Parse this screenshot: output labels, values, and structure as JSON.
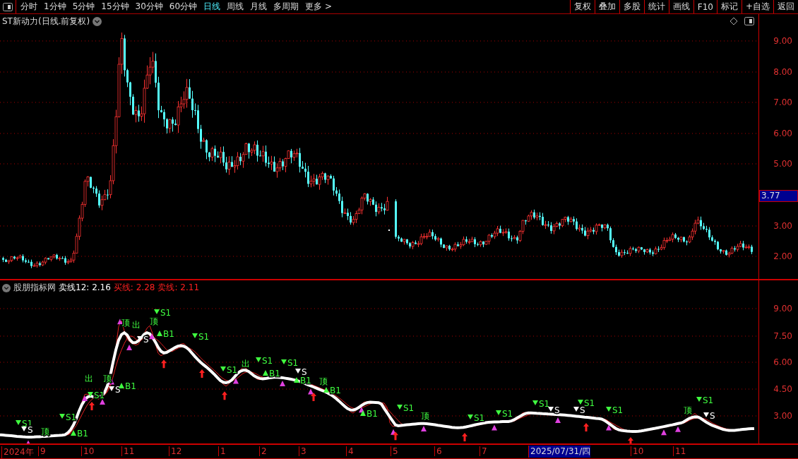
{
  "toolbar": {
    "periods": [
      {
        "label": "分时",
        "selected": false
      },
      {
        "label": "1分钟",
        "selected": false
      },
      {
        "label": "5分钟",
        "selected": false
      },
      {
        "label": "15分钟",
        "selected": false
      },
      {
        "label": "30分钟",
        "selected": false
      },
      {
        "label": "60分钟",
        "selected": false
      },
      {
        "label": "日线",
        "selected": true
      },
      {
        "label": "周线",
        "selected": false
      },
      {
        "label": "月线",
        "selected": false
      },
      {
        "label": "多周期",
        "selected": false
      },
      {
        "label": "更多 >",
        "selected": false
      }
    ],
    "buttons": [
      "复权",
      "叠加",
      "多股",
      "统计",
      "画线",
      "F10",
      "标记",
      "+自选",
      "返回"
    ]
  },
  "price_pane": {
    "title": "ST新动力(日线.前复权)",
    "y_ticks": [
      "9.00",
      "8.00",
      "7.00",
      "6.00",
      "5.00",
      "3.00",
      "2.00"
    ],
    "current_price": "3.77"
  },
  "indicator_pane": {
    "legend": [
      {
        "text": "股朋指标网",
        "kind": "source"
      },
      {
        "text": "卖线12: 2.16",
        "kind": "value"
      },
      {
        "text": "买线: 2.28",
        "kind": "signal"
      },
      {
        "text": "卖线: 2.11",
        "kind": "signal"
      }
    ],
    "y_ticks": [
      "9.00",
      "7.50",
      "6.00",
      "4.50",
      "3.00"
    ],
    "signals": [
      {
        "text": "S1",
        "kind": "sell"
      },
      {
        "text": "S",
        "kind": "exit"
      },
      {
        "text": "顶",
        "kind": "top"
      },
      {
        "text": "S1",
        "kind": "sell"
      },
      {
        "text": "B1",
        "kind": "buy"
      },
      {
        "text": "出",
        "kind": "top"
      },
      {
        "text": "S1",
        "kind": "sell"
      },
      {
        "text": "顶",
        "kind": "top"
      },
      {
        "text": "S",
        "kind": "exit"
      },
      {
        "text": "B1",
        "kind": "buy"
      },
      {
        "text": "顶",
        "kind": "top"
      },
      {
        "text": "出",
        "kind": "top"
      },
      {
        "text": "S1",
        "kind": "sell"
      },
      {
        "text": "顶",
        "kind": "top"
      },
      {
        "text": "B1",
        "kind": "buy"
      },
      {
        "text": "S",
        "kind": "exit"
      },
      {
        "text": "S1",
        "kind": "sell"
      },
      {
        "text": "S1",
        "kind": "sell"
      },
      {
        "text": "出",
        "kind": "top"
      },
      {
        "text": "S1",
        "kind": "sell"
      },
      {
        "text": "B1",
        "kind": "buy"
      },
      {
        "text": "S1",
        "kind": "sell"
      },
      {
        "text": "S",
        "kind": "exit"
      },
      {
        "text": "B1",
        "kind": "buy"
      },
      {
        "text": "顶",
        "kind": "top"
      },
      {
        "text": "B1",
        "kind": "buy"
      },
      {
        "text": "B1",
        "kind": "buy"
      },
      {
        "text": "S1",
        "kind": "sell"
      },
      {
        "text": "顶",
        "kind": "top"
      },
      {
        "text": "S1",
        "kind": "sell"
      },
      {
        "text": "S1",
        "kind": "sell"
      },
      {
        "text": "S1",
        "kind": "sell"
      },
      {
        "text": "S",
        "kind": "exit"
      },
      {
        "text": "S1",
        "kind": "sell"
      },
      {
        "text": "S",
        "kind": "exit"
      },
      {
        "text": "S1",
        "kind": "sell"
      },
      {
        "text": "顶",
        "kind": "top"
      },
      {
        "text": "S1",
        "kind": "sell"
      },
      {
        "text": "S",
        "kind": "exit"
      }
    ]
  },
  "date_axis": [
    {
      "text": "2024年",
      "kind": "label"
    },
    {
      "text": "9",
      "kind": "label"
    },
    {
      "text": "10",
      "kind": "label"
    },
    {
      "text": "11",
      "kind": "label"
    },
    {
      "text": "12",
      "kind": "label"
    },
    {
      "text": "1",
      "kind": "label"
    },
    {
      "text": "2",
      "kind": "label"
    },
    {
      "text": "3",
      "kind": "label"
    },
    {
      "text": "4",
      "kind": "label"
    },
    {
      "text": "5",
      "kind": "label"
    },
    {
      "text": "6",
      "kind": "label"
    },
    {
      "text": "7",
      "kind": "label"
    },
    {
      "text": "2025/07/31/四",
      "kind": "cursor"
    },
    {
      "text": "10",
      "kind": "label"
    },
    {
      "text": "11",
      "kind": "label"
    }
  ]
}
